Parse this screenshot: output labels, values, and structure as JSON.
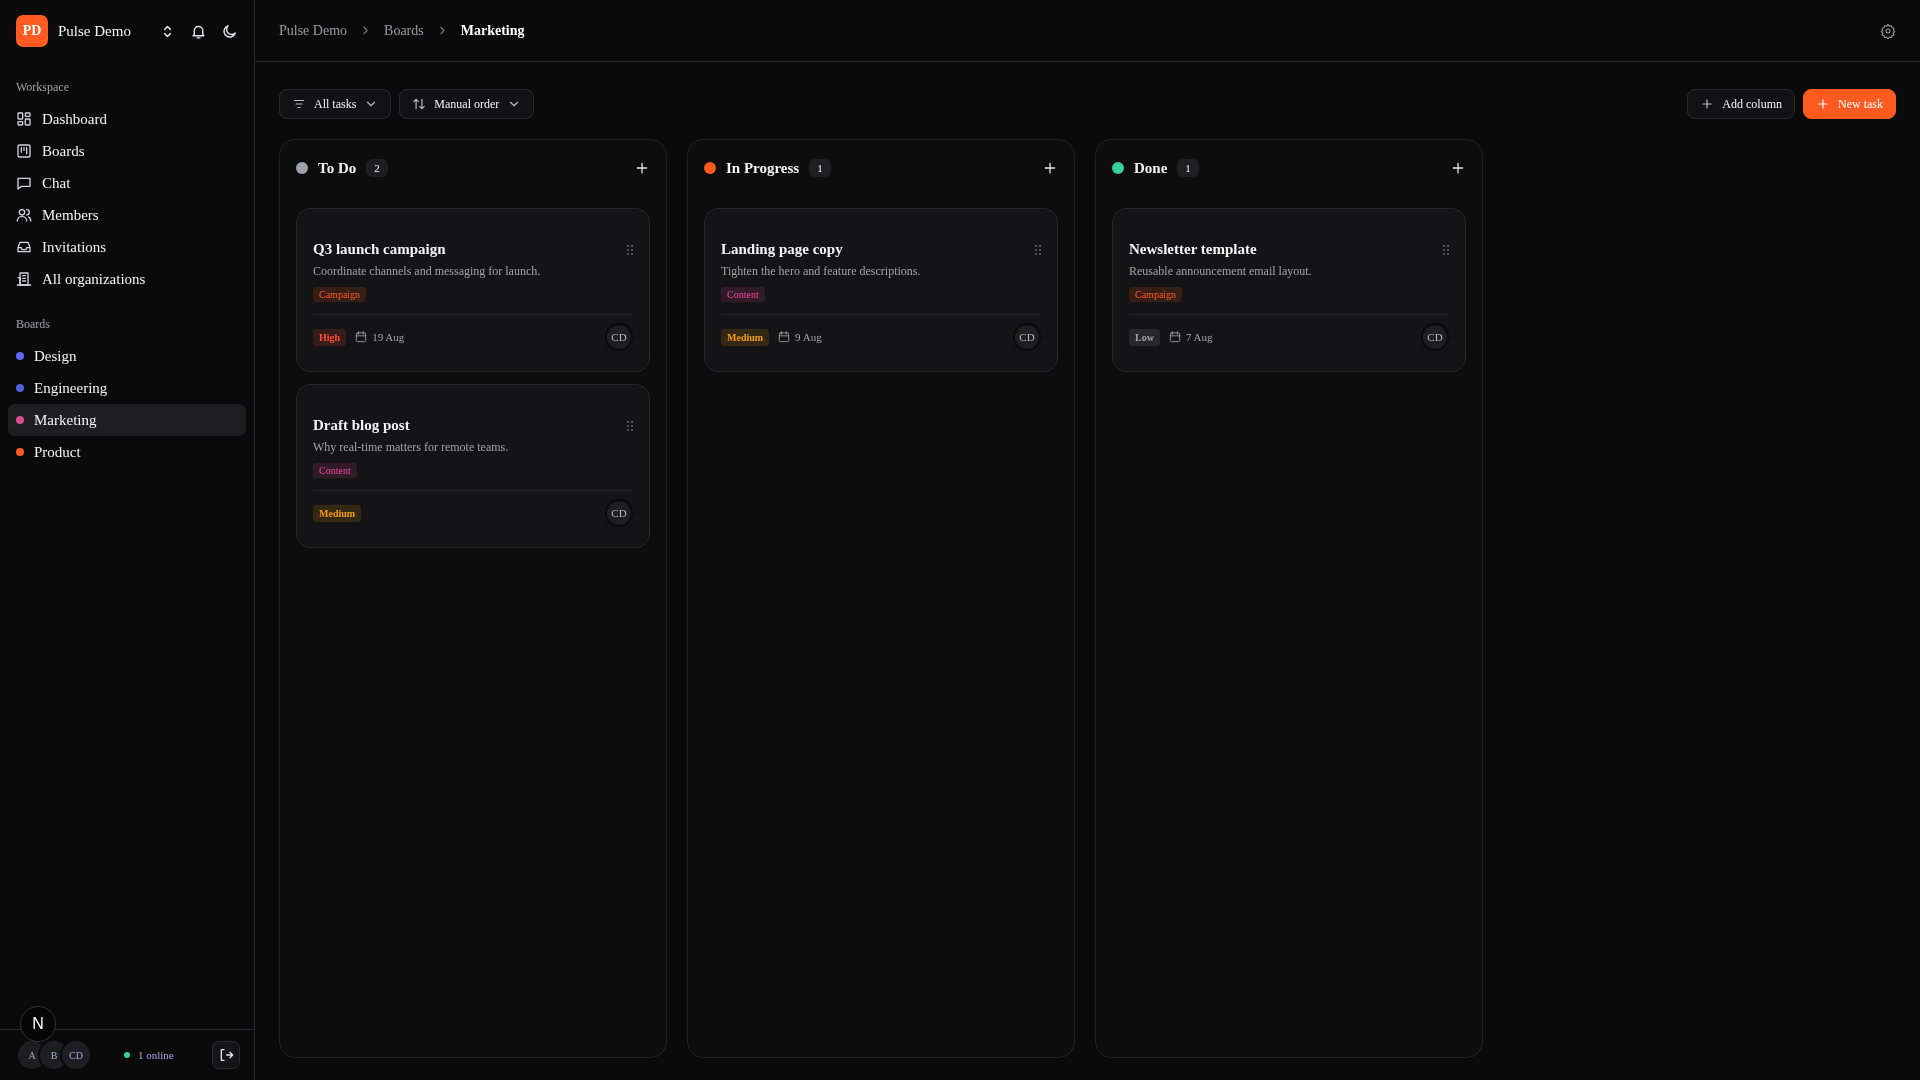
{
  "workspace": {
    "initials": "PD",
    "name": "Pulse Demo"
  },
  "sidebar": {
    "workspace_label": "Workspace",
    "items": [
      {
        "label": "Dashboard"
      },
      {
        "label": "Boards"
      },
      {
        "label": "Chat"
      },
      {
        "label": "Members"
      },
      {
        "label": "Invitations"
      },
      {
        "label": "All organizations"
      }
    ],
    "boards_label": "Boards",
    "boards": [
      {
        "label": "Design",
        "color": "#6366f1",
        "selected": false
      },
      {
        "label": "Engineering",
        "color": "#4f63d8",
        "selected": false
      },
      {
        "label": "Marketing",
        "color": "#db4e8e",
        "selected": true
      },
      {
        "label": "Product",
        "color": "#ff5a1f",
        "selected": false
      }
    ]
  },
  "footer": {
    "dev_badge": "N",
    "avatars": [
      "A",
      "B",
      "CD"
    ],
    "online": "1 online"
  },
  "breadcrumb": [
    "Pulse Demo",
    "Boards",
    "Marketing"
  ],
  "toolbar": {
    "filter": "All tasks",
    "sort": "Manual order",
    "add_column": "Add column",
    "new_task": "New task"
  },
  "columns": [
    {
      "title": "To Do",
      "color": "#a1a1aa",
      "count": "2",
      "cards": [
        {
          "title": "Q3 launch campaign",
          "description": "Coordinate channels and messaging for launch.",
          "tag": {
            "label": "Campaign",
            "kind": "campaign"
          },
          "priority": {
            "label": "High",
            "kind": "high"
          },
          "due": "19 Aug",
          "assignee": "CD"
        },
        {
          "title": "Draft blog post",
          "description": "Why real-time matters for remote teams.",
          "tag": {
            "label": "Content",
            "kind": "content"
          },
          "priority": {
            "label": "Medium",
            "kind": "medium"
          },
          "assignee": "CD"
        }
      ]
    },
    {
      "title": "In Progress",
      "color": "#ff5a1f",
      "count": "1",
      "cards": [
        {
          "title": "Landing page copy",
          "description": "Tighten the hero and feature descriptions.",
          "tag": {
            "label": "Content",
            "kind": "content"
          },
          "priority": {
            "label": "Medium",
            "kind": "medium"
          },
          "due": "9 Aug",
          "assignee": "CD"
        }
      ]
    },
    {
      "title": "Done",
      "color": "#34d399",
      "count": "1",
      "cards": [
        {
          "title": "Newsletter template",
          "description": "Reusable announcement email layout.",
          "tag": {
            "label": "Campaign",
            "kind": "campaign"
          },
          "priority": {
            "label": "Low",
            "kind": "low"
          },
          "due": "7 Aug",
          "assignee": "CD"
        }
      ]
    }
  ]
}
